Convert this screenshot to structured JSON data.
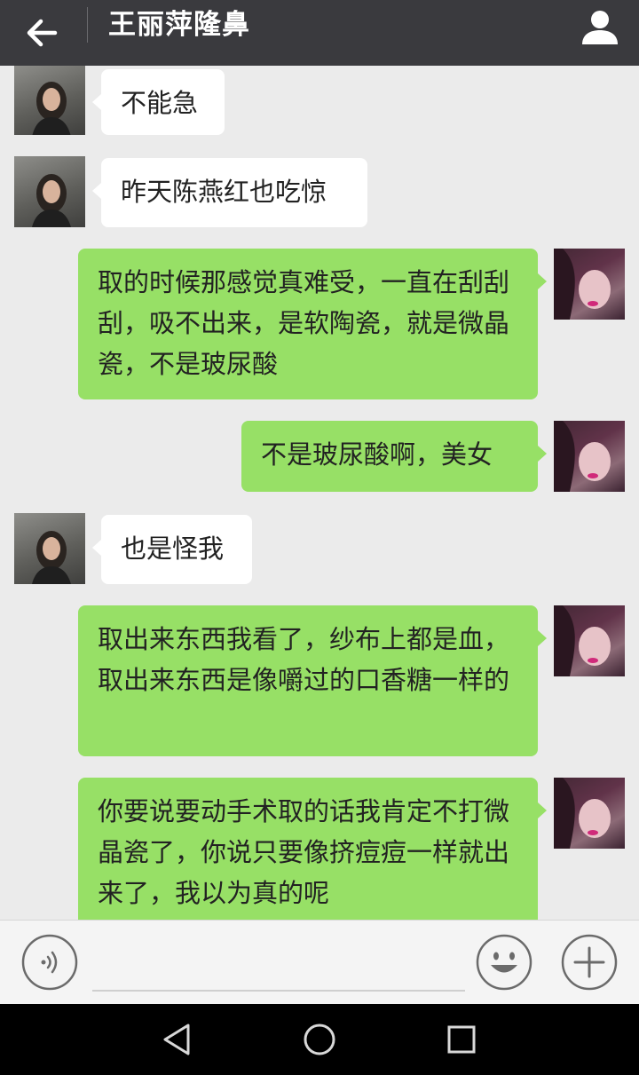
{
  "header": {
    "title": "王丽萍隆鼻",
    "back_icon": "arrow-left-icon",
    "profile_icon": "person-icon"
  },
  "messages": [
    {
      "side": "left",
      "text": "不能急"
    },
    {
      "side": "left",
      "text": "昨天陈燕红也吃惊"
    },
    {
      "side": "right",
      "text": "取的时候那感觉真难受，一直在刮刮刮，吸不出来，是软陶瓷，就是微晶瓷，不是玻尿酸"
    },
    {
      "side": "right",
      "text": "不是玻尿酸啊，美女"
    },
    {
      "side": "left",
      "text": "也是怪我"
    },
    {
      "side": "right",
      "text": "取出来东西我看了，纱布上都是血，取出来东西是像嚼过的口香糖一样的"
    },
    {
      "side": "right",
      "text": "你要说要动手术取的话我肯定不打微晶瓷了，你说只要像挤痘痘一样就出来了，我以为真的呢"
    }
  ],
  "input_bar": {
    "voice_icon": "voice-icon",
    "input_value": "",
    "emoji_icon": "emoji-icon",
    "plus_icon": "plus-icon"
  },
  "nav_bar": {
    "back_icon": "triangle-back-icon",
    "home_icon": "circle-home-icon",
    "recents_icon": "square-recents-icon"
  },
  "colors": {
    "header_bg": "#3a3a3e",
    "chat_bg": "#ebebeb",
    "sent_bubble": "#97e066",
    "received_bubble": "#ffffff"
  }
}
